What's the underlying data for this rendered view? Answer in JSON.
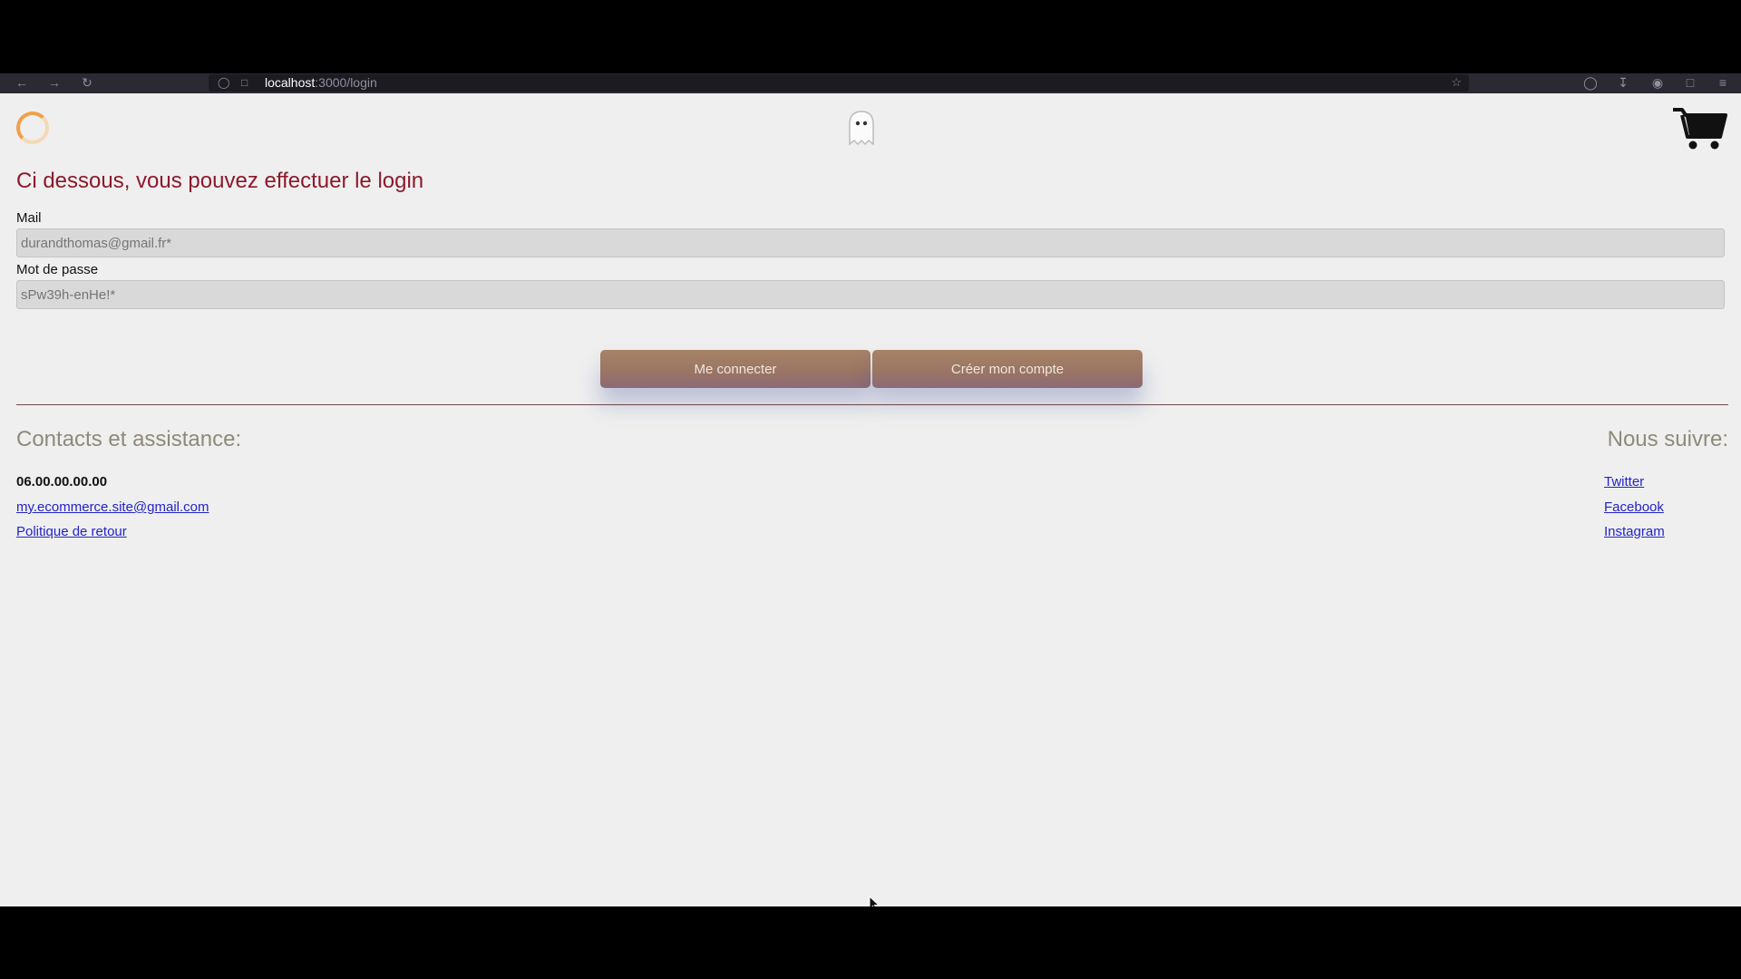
{
  "browser": {
    "url_host": "localhost",
    "url_path": ":3000/login"
  },
  "header": {
    "loader_icon": "loading-spinner-icon",
    "logo_icon": "ghost-icon",
    "cart_icon": "shopping-cart-icon"
  },
  "login": {
    "title": "Ci dessous, vous pouvez effectuer le login",
    "mail_label": "Mail",
    "mail_placeholder": "durandthomas@gmail.fr*",
    "password_label": "Mot de passe",
    "password_placeholder": "sPw39h-enHe!*",
    "connect_button": "Me connecter",
    "create_button": "Créer mon compte"
  },
  "footer": {
    "contacts_heading": "Contacts et assistance:",
    "phone": "06.00.00.00.00",
    "email_link": "my.ecommerce.site@gmail.com",
    "returns_link": "Politique de retour",
    "follow_heading": "Nous suivre:",
    "social_links": [
      "Twitter",
      "Facebook",
      "Instagram"
    ]
  },
  "colors": {
    "title": "#8b1a2b",
    "button": "#9a7464",
    "link": "#2323c8",
    "section_heading": "#8e8a7a",
    "page_bg": "#efefef"
  }
}
